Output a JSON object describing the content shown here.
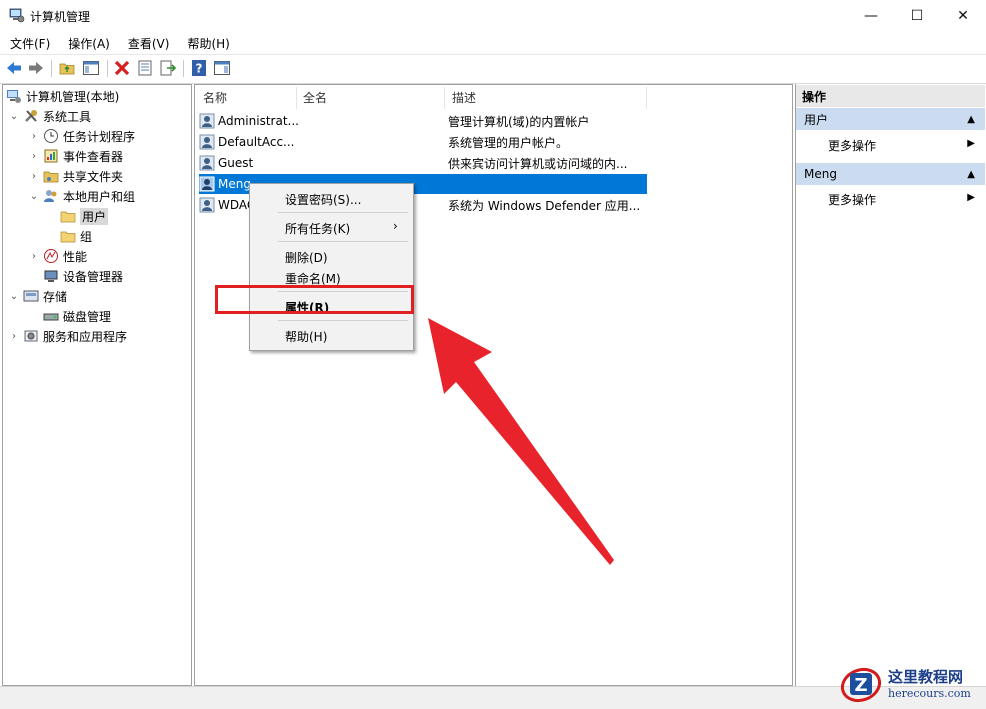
{
  "window": {
    "title": "计算机管理",
    "controls": {
      "minimize": "—",
      "maximize": "☐",
      "close": "✕"
    }
  },
  "menubar": [
    "文件(F)",
    "操作(A)",
    "查看(V)",
    "帮助(H)"
  ],
  "tree": {
    "root": "计算机管理(本地)",
    "system_tools": "系统工具",
    "task_scheduler": "任务计划程序",
    "event_viewer": "事件查看器",
    "shared_folders": "共享文件夹",
    "local_users": "本地用户和组",
    "users": "用户",
    "groups": "组",
    "performance": "性能",
    "device_manager": "设备管理器",
    "storage": "存储",
    "disk_management": "磁盘管理",
    "services_apps": "服务和应用程序"
  },
  "list": {
    "columns": {
      "name": "名称",
      "fullname": "全名",
      "description": "描述"
    },
    "rows": [
      {
        "name": "Administrat...",
        "fullname": "",
        "description": "管理计算机(域)的内置帐户"
      },
      {
        "name": "DefaultAcc...",
        "fullname": "",
        "description": "系统管理的用户帐户。"
      },
      {
        "name": "Guest",
        "fullname": "",
        "description": "供来宾访问计算机或访问域的内..."
      },
      {
        "name": "Meng",
        "fullname": "",
        "description": ""
      },
      {
        "name": "WDAG",
        "fullname": "",
        "description": "系统为 Windows Defender 应用..."
      }
    ]
  },
  "context_menu": {
    "set_password": "设置密码(S)...",
    "all_tasks": "所有任务(K)",
    "delete": "删除(D)",
    "rename": "重命名(M)",
    "properties": "属性(R)",
    "help": "帮助(H)"
  },
  "actions_pane": {
    "header": "操作",
    "section1": "用户",
    "more1": "更多操作",
    "section2": "Meng",
    "more2": "更多操作"
  },
  "watermark": {
    "title": "这里教程网",
    "url": "herecours.com"
  },
  "colors": {
    "selection": "#0078d7",
    "highlight_box": "#e02020",
    "arrow": "#e8232b"
  }
}
